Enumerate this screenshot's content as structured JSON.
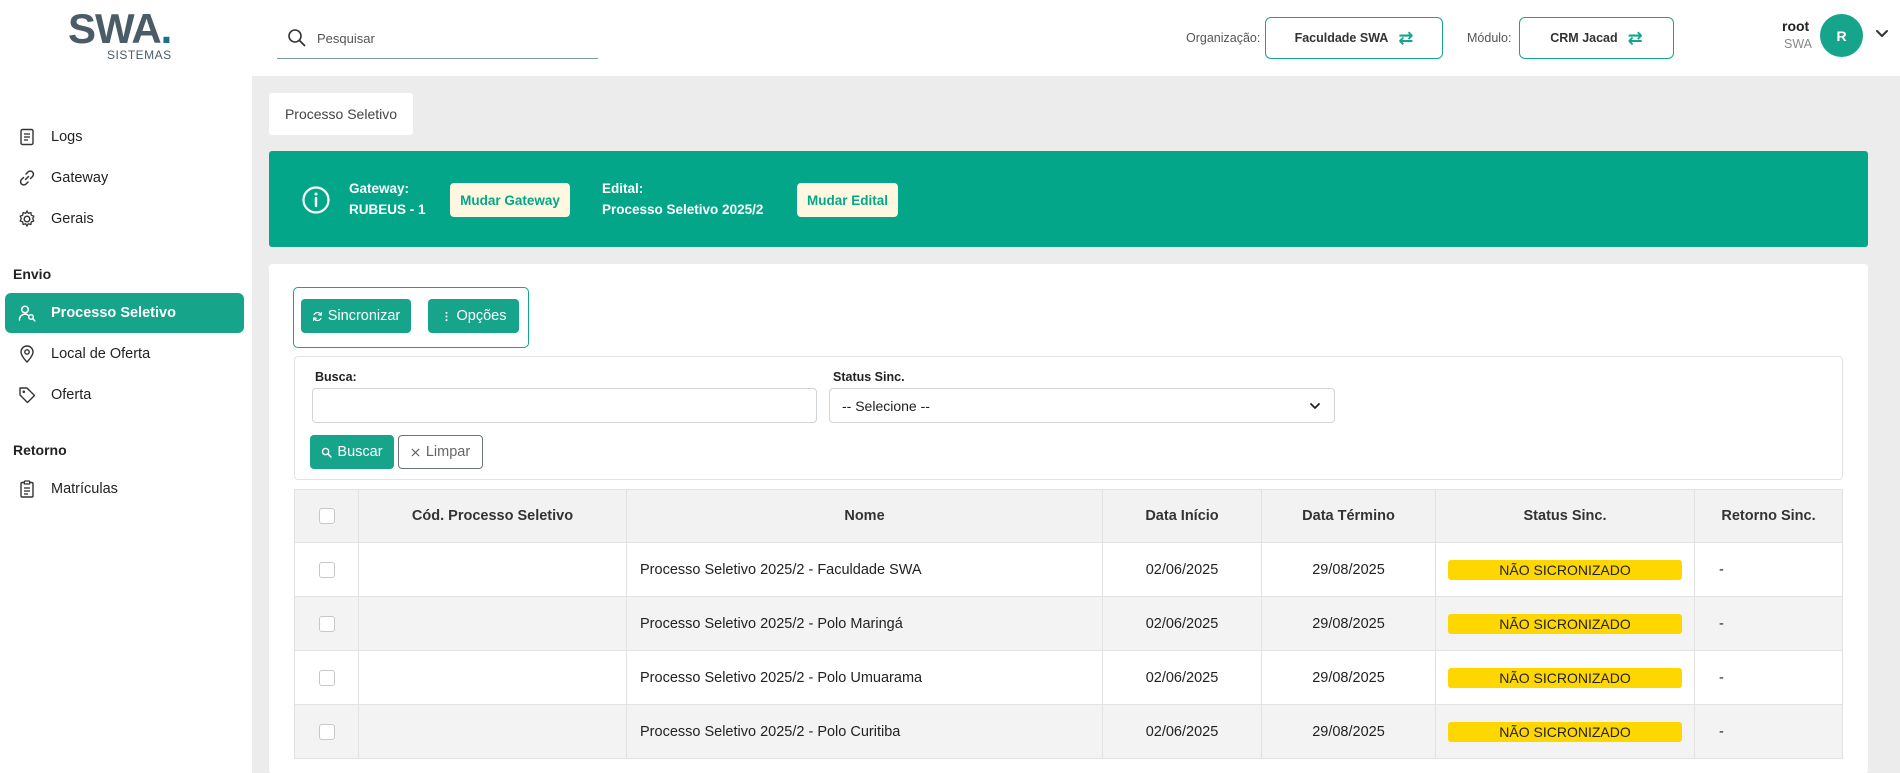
{
  "header": {
    "logo_text": "SWA",
    "logo_dot": ".",
    "logo_sub": "SISTEMAS",
    "search_placeholder": "Pesquisar",
    "org_label": "Organização:",
    "org_value": "Faculdade SWA",
    "module_label": "Módulo:",
    "module_value": "CRM Jacad",
    "swap_glyph": "⇄",
    "user_name": "root",
    "user_org": "SWA",
    "avatar_initial": "R"
  },
  "sidebar": {
    "items_top": [
      {
        "label": "Logs",
        "icon": "logs-icon"
      },
      {
        "label": "Gateway",
        "icon": "link-icon"
      },
      {
        "label": "Gerais",
        "icon": "gear-icon"
      }
    ],
    "section_envio": "Envio",
    "items_envio": [
      {
        "label": "Processo Seletivo",
        "icon": "user-search-icon",
        "active": true
      },
      {
        "label": "Local de Oferta",
        "icon": "map-pin-icon"
      },
      {
        "label": "Oferta",
        "icon": "tag-icon"
      }
    ],
    "section_retorno": "Retorno",
    "items_retorno": [
      {
        "label": "Matrículas",
        "icon": "clipboard-icon"
      }
    ]
  },
  "breadcrumb": "Processo Seletivo",
  "banner": {
    "gateway_label": "Gateway:",
    "gateway_value": "RUBEUS - 1",
    "gateway_button": "Mudar Gateway",
    "edital_label": "Edital:",
    "edital_value": "Processo Seletivo 2025/2",
    "edital_button": "Mudar Edital"
  },
  "actions": {
    "sync_label": "Sincronizar",
    "options_label": "Opções"
  },
  "filters": {
    "busca_label": "Busca:",
    "busca_value": "",
    "status_label": "Status Sinc.",
    "status_value": "-- Selecione --",
    "buscar_label": "Buscar",
    "limpar_label": "Limpar"
  },
  "table": {
    "columns": [
      "Cód. Processo Seletivo",
      "Nome",
      "Data Início",
      "Data Término",
      "Status Sinc.",
      "Retorno Sinc."
    ],
    "rows": [
      {
        "cod": "",
        "nome": "Processo Seletivo 2025/2 - Faculdade SWA",
        "inicio": "02/06/2025",
        "termino": "29/08/2025",
        "status": "NÃO SICRONIZADO",
        "retorno": "-"
      },
      {
        "cod": "",
        "nome": "Processo Seletivo 2025/2 - Polo Maringá",
        "inicio": "02/06/2025",
        "termino": "29/08/2025",
        "status": "NÃO SICRONIZADO",
        "retorno": "-"
      },
      {
        "cod": "",
        "nome": "Processo Seletivo 2025/2 - Polo Umuarama",
        "inicio": "02/06/2025",
        "termino": "29/08/2025",
        "status": "NÃO SICRONIZADO",
        "retorno": "-"
      },
      {
        "cod": "",
        "nome": "Processo Seletivo 2025/2 - Polo Curitiba",
        "inicio": "02/06/2025",
        "termino": "29/08/2025",
        "status": "NÃO SICRONIZADO",
        "retorno": "-"
      }
    ]
  },
  "colors": {
    "accent": "#16a58b",
    "banner": "#04a68a",
    "badge": "#ffd700",
    "banner_button_bg": "#fdf8df"
  }
}
